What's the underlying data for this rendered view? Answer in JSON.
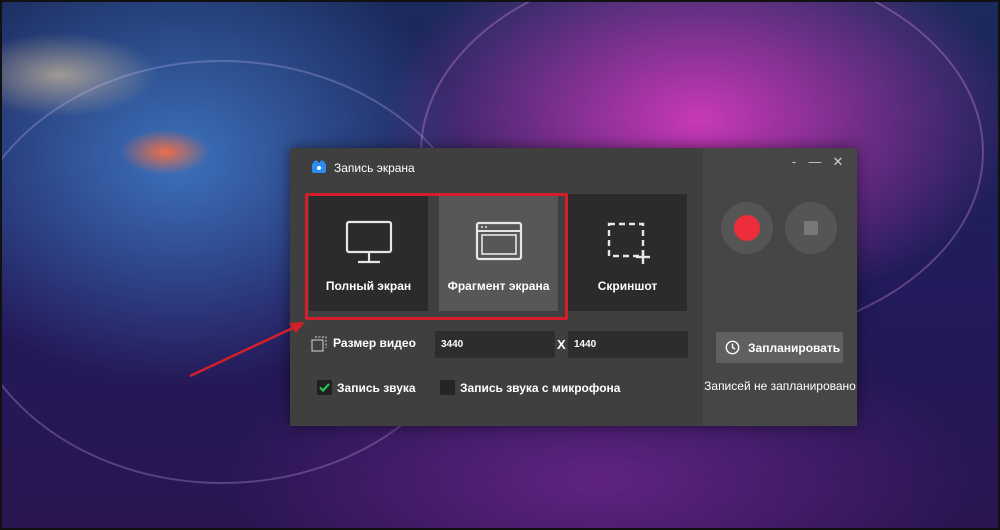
{
  "window": {
    "title": "Запись экрана",
    "icons": {
      "app": "camera-icon",
      "minimize": "minimize-icon",
      "maximize": "maximize-icon",
      "close": "close-icon"
    }
  },
  "modes": {
    "full_screen": {
      "label": "Полный экран",
      "icon": "monitor-icon"
    },
    "fragment": {
      "label": "Фрагмент экрана",
      "icon": "window-icon"
    },
    "screenshot": {
      "label": "Скриншот",
      "icon": "crop-plus-icon"
    }
  },
  "video_size": {
    "label": "Размер видео",
    "width": "3440",
    "separator": "X",
    "height": "1440"
  },
  "audio": {
    "system_sound": {
      "label": "Запись звука",
      "checked": true
    },
    "microphone": {
      "label": "Запись звука с микрофона",
      "checked": false
    }
  },
  "controls": {
    "record_icon": "record-icon",
    "stop_icon": "stop-icon"
  },
  "schedule": {
    "button_label": "Запланировать",
    "icon": "clock-icon",
    "status": "Записей не запланировано"
  },
  "colors": {
    "highlight": "#d21f2a",
    "record": "#ee2d3c",
    "check": "#27c24c"
  }
}
